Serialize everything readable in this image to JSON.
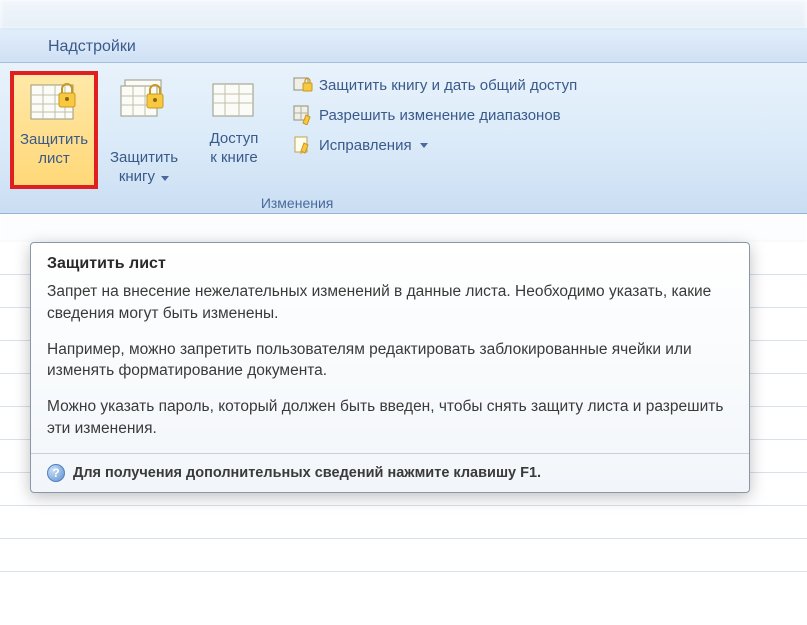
{
  "tab": {
    "label": "Надстройки"
  },
  "ribbon": {
    "protect_sheet": {
      "label": "Защитить\nлист"
    },
    "protect_workbook": {
      "label": "Защитить\nкнигу"
    },
    "share_workbook": {
      "label": "Доступ\nк книге"
    },
    "protect_share": {
      "label": "Защитить книгу и дать общий доступ"
    },
    "allow_ranges": {
      "label": "Разрешить изменение диапазонов"
    },
    "track_changes": {
      "label": "Исправления"
    },
    "group_label": "Изменения"
  },
  "tooltip": {
    "title": "Защитить лист",
    "p1": "Запрет на внесение нежелательных изменений в данные листа. Необходимо указать, какие сведения могут быть изменены.",
    "p2": "Например, можно запретить пользователям редактировать заблокированные ячейки или изменять форматирование документа.",
    "p3": "Можно указать пароль, который должен быть введен, чтобы снять защиту листа и разрешить эти изменения.",
    "footer": "Для получения дополнительных сведений нажмите клавишу F1."
  }
}
